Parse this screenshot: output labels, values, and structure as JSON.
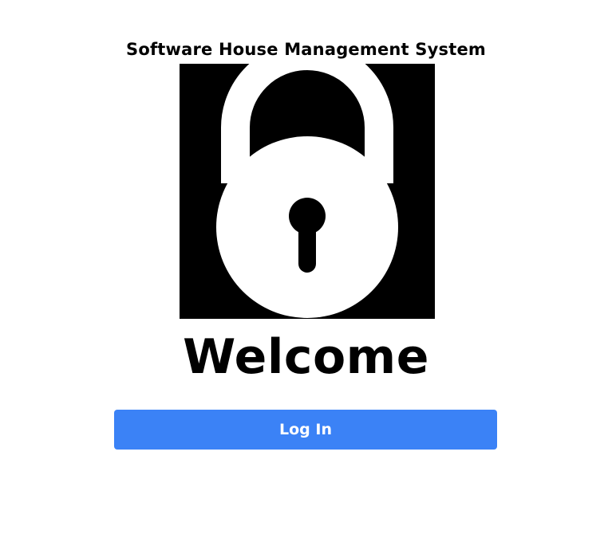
{
  "header": {
    "title": "Software House Management System"
  },
  "hero": {
    "icon": "padlock-icon",
    "welcome_text": "Welcome"
  },
  "actions": {
    "login_label": "Log In",
    "login_color": "#3b82f6"
  }
}
